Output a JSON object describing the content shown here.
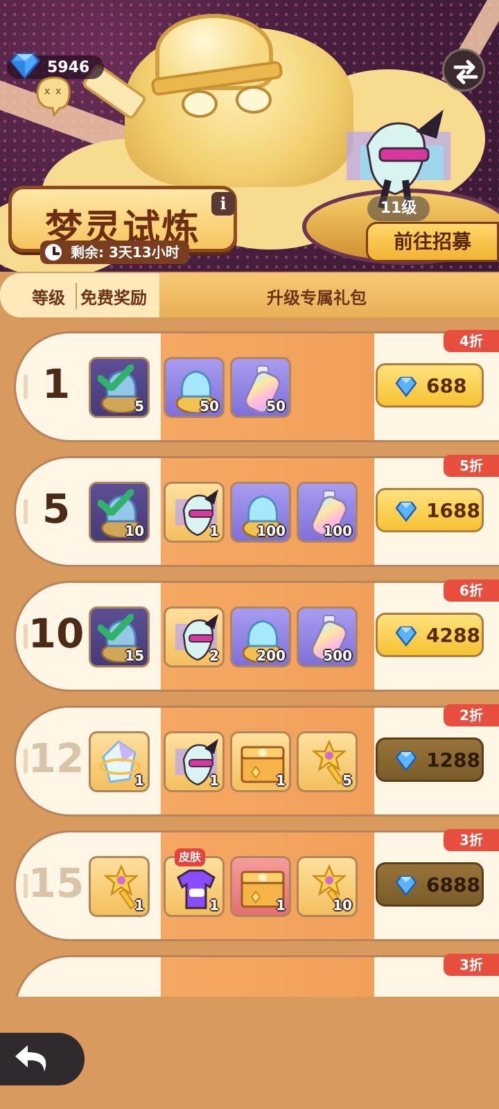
{
  "header": {
    "gem_count": "5946",
    "title": "梦灵试炼",
    "info_label": "i",
    "timer_text": "剩余: 3天13小时",
    "hero_level": "11级",
    "recruit_label": "前往招募"
  },
  "columns": {
    "level": "等级",
    "free": "免费奖励",
    "upgrade": "升级专属礼包"
  },
  "rows": [
    {
      "level": "1",
      "discount": "4折",
      "price": "688",
      "free_qty": "5",
      "items": [
        "50",
        "50"
      ],
      "locked": false
    },
    {
      "level": "5",
      "discount": "5折",
      "price": "1688",
      "free_qty": "10",
      "items": [
        "1",
        "100",
        "100"
      ],
      "locked": false
    },
    {
      "level": "10",
      "discount": "6折",
      "price": "4288",
      "free_qty": "15",
      "items": [
        "2",
        "200",
        "500"
      ],
      "locked": false
    },
    {
      "level": "12",
      "discount": "2折",
      "price": "1288",
      "free_qty": "1",
      "items": [
        "1",
        "1",
        "5"
      ],
      "locked": true
    },
    {
      "level": "15",
      "discount": "3折",
      "price": "6888",
      "free_qty": "1",
      "items": [
        "1",
        "1",
        "10"
      ],
      "skin_tag": "皮肤",
      "locked": true
    },
    {
      "level": "",
      "discount": "3折",
      "price": "",
      "locked": true
    }
  ],
  "colors": {
    "accent": "#f5c232",
    "discount_tag": "#e74e3e",
    "row_bg": "#fff6e6",
    "page_bg": "#d99a5e"
  },
  "icons": {
    "gem": "blue-diamond-icon",
    "swap": "swap-arrows-icon",
    "back": "back-arrow-icon",
    "clock": "clock-icon",
    "check": "checkmark-icon"
  }
}
